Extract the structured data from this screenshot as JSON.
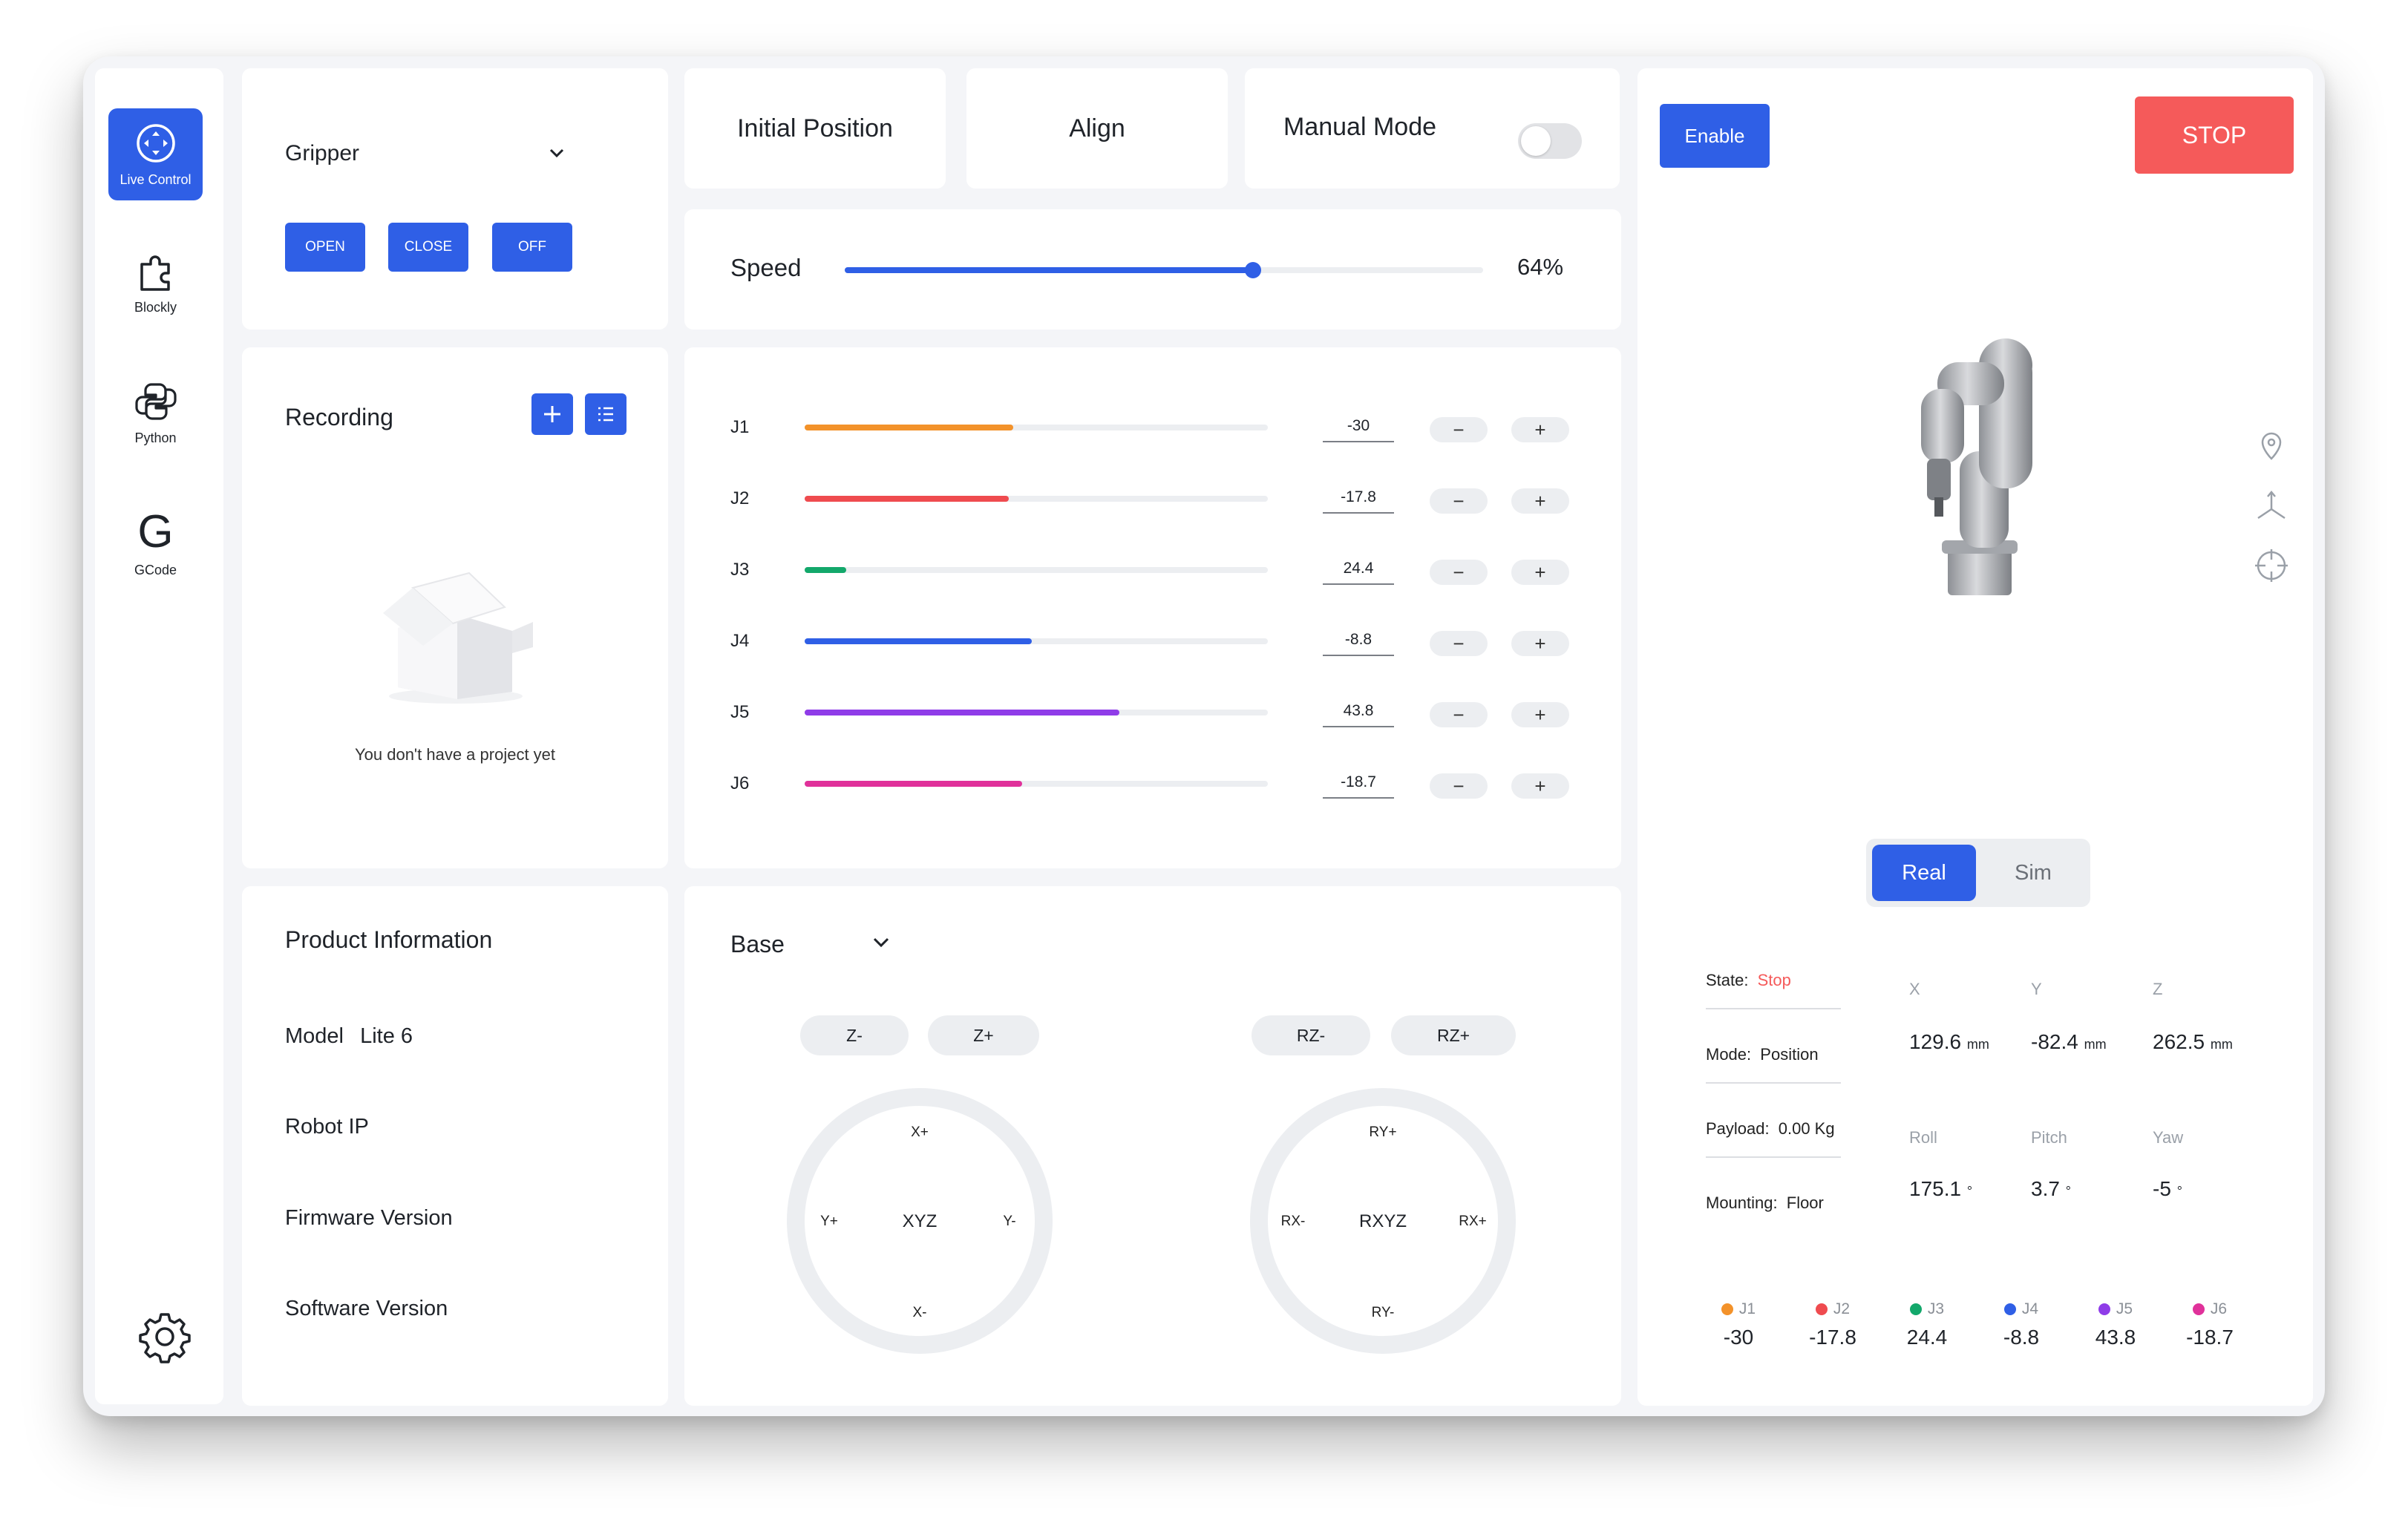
{
  "nav": {
    "items": [
      {
        "label": "Live Control",
        "icon": "move-arrows-icon",
        "active": true
      },
      {
        "label": "Blockly",
        "icon": "puzzle-icon"
      },
      {
        "label": "Python",
        "icon": "python-icon"
      },
      {
        "label": "GCode",
        "icon": "gcode-icon",
        "glyph": "G"
      }
    ],
    "settings_icon": "gear-icon"
  },
  "gripper": {
    "title": "Gripper",
    "buttons": [
      "OPEN",
      "CLOSE",
      "OFF"
    ]
  },
  "actions": {
    "initial_position": "Initial Position",
    "align": "Align",
    "manual_mode": "Manual Mode",
    "manual_mode_on": false
  },
  "speed": {
    "label": "Speed",
    "value_text": "64%",
    "fraction": 0.64
  },
  "recording": {
    "title": "Recording",
    "empty_text": "You don't have a project yet"
  },
  "joints": [
    {
      "label": "J1",
      "value": "-30",
      "fraction": 0.45,
      "color": "#f3922a"
    },
    {
      "label": "J2",
      "value": "-17.8",
      "fraction": 0.44,
      "color": "#ef4b4f"
    },
    {
      "label": "J3",
      "value": "24.4",
      "fraction": 0.09,
      "color": "#13a86b"
    },
    {
      "label": "J4",
      "value": "-8.8",
      "fraction": 0.49,
      "color": "#2f5fe6"
    },
    {
      "label": "J5",
      "value": "43.8",
      "fraction": 0.68,
      "color": "#8f3ce8"
    },
    {
      "label": "J6",
      "value": "-18.7",
      "fraction": 0.47,
      "color": "#e0319a"
    }
  ],
  "product": {
    "title": "Product Information",
    "model_label": "Model",
    "model_value": "Lite 6",
    "robot_ip_label": "Robot IP",
    "firmware_label": "Firmware Version",
    "software_label": "Software Version"
  },
  "jog": {
    "frame": "Base",
    "linear": {
      "z_minus": "Z-",
      "z_plus": "Z+",
      "center": "XYZ",
      "top": "X+",
      "bottom": "X-",
      "left": "Y+",
      "right": "Y-"
    },
    "rotary": {
      "z_minus": "RZ-",
      "z_plus": "RZ+",
      "center": "RXYZ",
      "top": "RY+",
      "bottom": "RY-",
      "left": "RX-",
      "right": "RX+"
    }
  },
  "control": {
    "enable": "Enable",
    "stop": "STOP"
  },
  "view": {
    "real": "Real",
    "sim": "Sim",
    "selected": "Real"
  },
  "status": {
    "state_label": "State:",
    "state_value": "Stop",
    "mode_label": "Mode:",
    "mode_value": "Position",
    "payload_label": "Payload:",
    "payload_value": "0.00 Kg",
    "mounting_label": "Mounting:",
    "mounting_value": "Floor"
  },
  "position": {
    "x_label": "X",
    "x": "129.6",
    "y_label": "Y",
    "y": "-82.4",
    "z_label": "Z",
    "z": "262.5",
    "unit": "mm",
    "roll_label": "Roll",
    "roll": "175.1",
    "pitch_label": "Pitch",
    "pitch": "3.7",
    "yaw_label": "Yaw",
    "yaw": "-5",
    "deg": "°"
  },
  "colors": {
    "primary": "#2f5fe6",
    "stop": "#f55a5a",
    "panel_bg": "#f4f5f8"
  }
}
